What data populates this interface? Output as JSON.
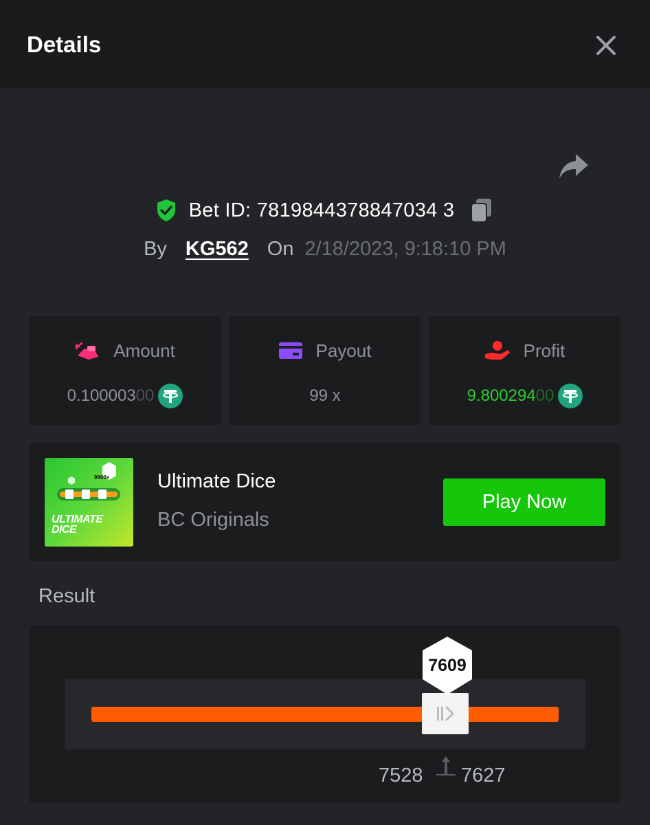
{
  "header": {
    "title": "Details"
  },
  "bet": {
    "id_text": "Bet ID: 7819844378847034 3",
    "by_label": "By",
    "user": "KG562",
    "on_label": "On",
    "date": "2/18/2023, 9:18:10 PM"
  },
  "stats": {
    "amount": {
      "label": "Amount",
      "value_main": "0.100003",
      "value_faded": "00"
    },
    "payout": {
      "label": "Payout",
      "value": "99 x"
    },
    "profit": {
      "label": "Profit",
      "value_main": "9.800294",
      "value_faded": "00"
    }
  },
  "game": {
    "name": "Ultimate Dice",
    "provider": "BC Originals",
    "thumb_text_line1": "ULTIMATE",
    "thumb_text_line2": "DICE",
    "thumb_badge": "9900×",
    "play_label": "Play Now"
  },
  "result": {
    "label": "Result",
    "value": "7609",
    "range_low": "7528",
    "range_high": "7627"
  },
  "colors": {
    "accent_green": "#16c60b",
    "profit_green": "#2ecc2e",
    "slider_orange": "#ff5b00",
    "amount_pink": "#ff2d78",
    "payout_purple": "#8b4dff",
    "profit_red": "#ff2b2b"
  },
  "icons": {
    "close": "close-icon",
    "share": "share-icon",
    "verified": "shield-check-icon",
    "copy": "copy-icon",
    "amount": "coins-icon",
    "payout": "card-icon",
    "profit": "hand-money-icon",
    "currency": "tether-icon"
  }
}
